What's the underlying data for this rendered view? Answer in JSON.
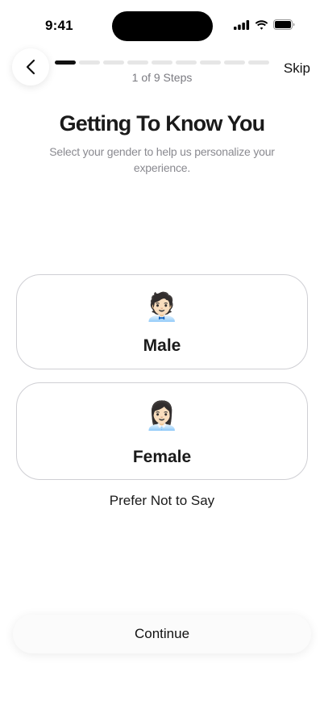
{
  "status_bar": {
    "time": "9:41",
    "icons": [
      "cellular-signal-icon",
      "wifi-icon",
      "battery-icon"
    ]
  },
  "header": {
    "back_icon": "chevron-left-icon",
    "progress": {
      "current": 1,
      "total": 9
    },
    "step_label": "1 of 9 Steps",
    "skip_label": "Skip"
  },
  "content": {
    "title": "Getting To Know You",
    "subtitle": "Select your gender to help us personalize your experience."
  },
  "options": [
    {
      "emoji": "🧑🏻‍💼",
      "label": "Male"
    },
    {
      "emoji": "👩🏻‍💼",
      "label": "Female"
    }
  ],
  "prefer_not_label": "Prefer Not to Say",
  "continue_label": "Continue",
  "colors": {
    "progress_active": "#111111",
    "progress_inactive": "#e6e6e6",
    "card_border": "#cfcfd4",
    "muted_text": "#8a8a90"
  }
}
